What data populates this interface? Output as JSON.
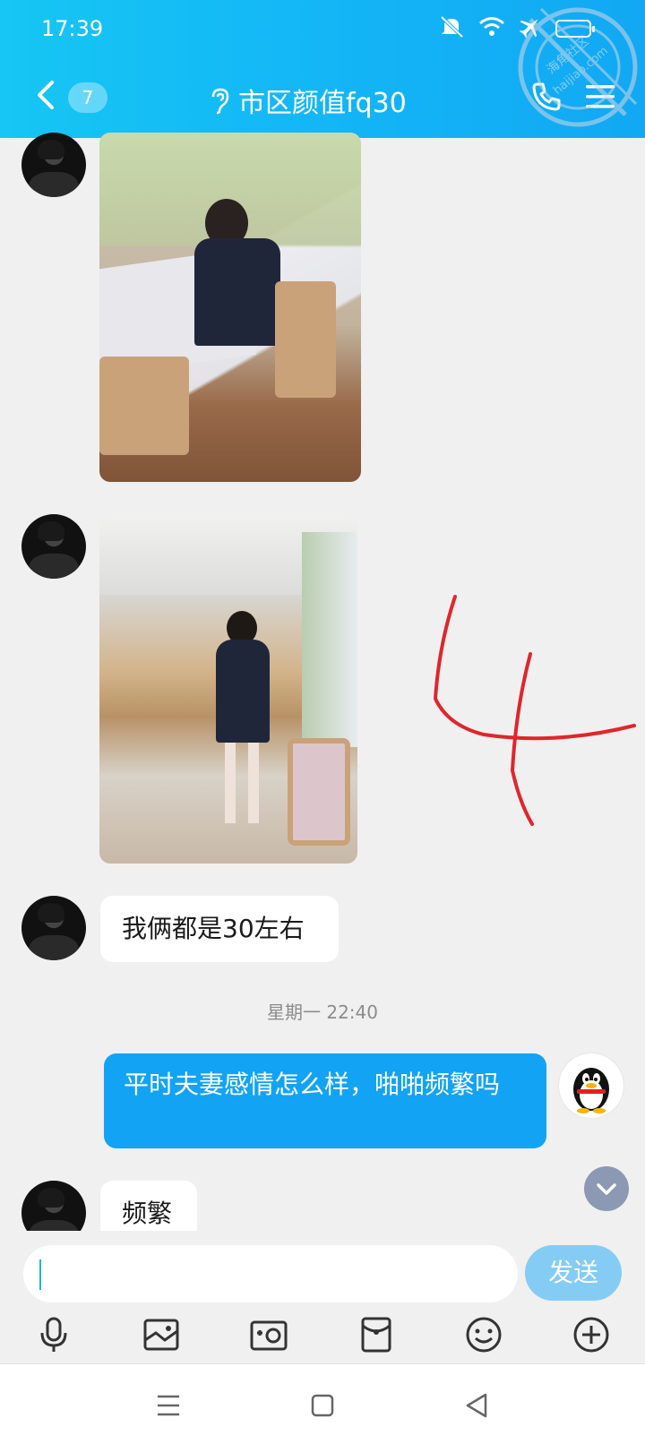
{
  "status_bar": {
    "time": "17:39",
    "icons": [
      "mute-icon",
      "wifi-icon",
      "airplane-icon",
      "battery-icon"
    ]
  },
  "header": {
    "unread_count": "7",
    "title": "市区颜值fq30",
    "icons": [
      "back-icon",
      "earpiece-icon",
      "phone-icon",
      "menu-icon"
    ],
    "background_color": "#13b3f6"
  },
  "watermark": {
    "text_line1": "海角社区",
    "text_line2": "haijiao.com"
  },
  "messages": [
    {
      "sender": "other",
      "type": "image",
      "description_icon": "photo-woman-sitting"
    },
    {
      "sender": "other",
      "type": "image",
      "description_icon": "photo-woman-standing"
    },
    {
      "sender": "other",
      "type": "text",
      "text": "我俩都是30左右"
    },
    {
      "sender": "system",
      "type": "timestamp",
      "text": "星期一 22:40"
    },
    {
      "sender": "self",
      "type": "text",
      "text": "平时夫妻感情怎么样，啪啪频繁吗"
    },
    {
      "sender": "other",
      "type": "text",
      "text": "频繁"
    }
  ],
  "annotation": {
    "text": "4",
    "color": "#e0252b"
  },
  "input": {
    "value": "",
    "placeholder": "",
    "send_label": "发送"
  },
  "toolbar": [
    "microphone-icon",
    "image-icon",
    "camera-icon",
    "red-envelope-icon",
    "emoji-icon",
    "plus-icon"
  ],
  "nav_bar": [
    "menu-nav-icon",
    "home-nav-icon",
    "back-nav-icon"
  ],
  "colors": {
    "bubble_out": "#12a3f5",
    "send_button": "#84ccf4",
    "background": "#f0f0f0"
  }
}
